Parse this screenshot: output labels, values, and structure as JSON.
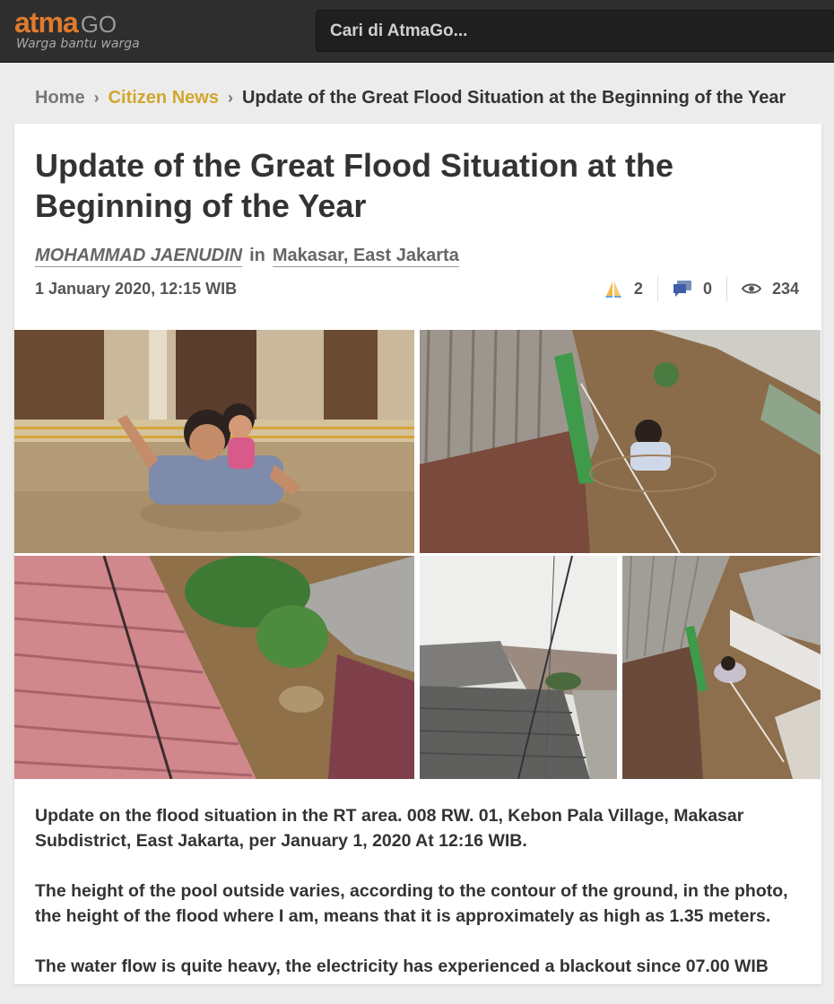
{
  "header": {
    "logo_atma": "atma",
    "logo_go": "GO",
    "logo_tagline": "Warga bantu warga",
    "search_placeholder": "Cari di AtmaGo...",
    "colors": {
      "bar": "#2e2e2e",
      "brand": "#e07a2e"
    }
  },
  "breadcrumb": {
    "home": "Home",
    "category": "Citizen News",
    "separator": "›",
    "current": "Update of the Great Flood Situation at the Beginning of the Year"
  },
  "article": {
    "title": "Update of the Great Flood Situation at the Beginning of the Year",
    "author": "MOHAMMAD JAENUDIN",
    "in_word": "in",
    "location": "Makasar, East Jakarta",
    "date": "1 January 2020, 12:15 WIB",
    "stats": {
      "thanks": {
        "icon": "praying-hands-icon",
        "count": "2"
      },
      "comments": {
        "icon": "comment-icon",
        "count": "0"
      },
      "views": {
        "icon": "eye-icon",
        "count": "234"
      }
    },
    "photos": [
      {
        "name": "photo-man-with-child-in-flood"
      },
      {
        "name": "photo-man-in-flood-from-above"
      },
      {
        "name": "photo-flooded-roofs"
      },
      {
        "name": "photo-rooftops-and-wires"
      },
      {
        "name": "photo-flooded-alley"
      }
    ],
    "paragraphs": [
      "Update on the flood situation in the RT area. 008 RW. 01, Kebon Pala Village, Makasar Subdistrict, East Jakarta, per January 1, 2020 At 12:16 WIB.",
      "The height of the pool outside varies, according to the contour of the ground, in the photo, the height of the flood where I am, means that it is approximately as high as 1.35 meters.",
      "The water flow is quite heavy, the electricity has experienced a blackout since 07.00 WIB"
    ]
  }
}
